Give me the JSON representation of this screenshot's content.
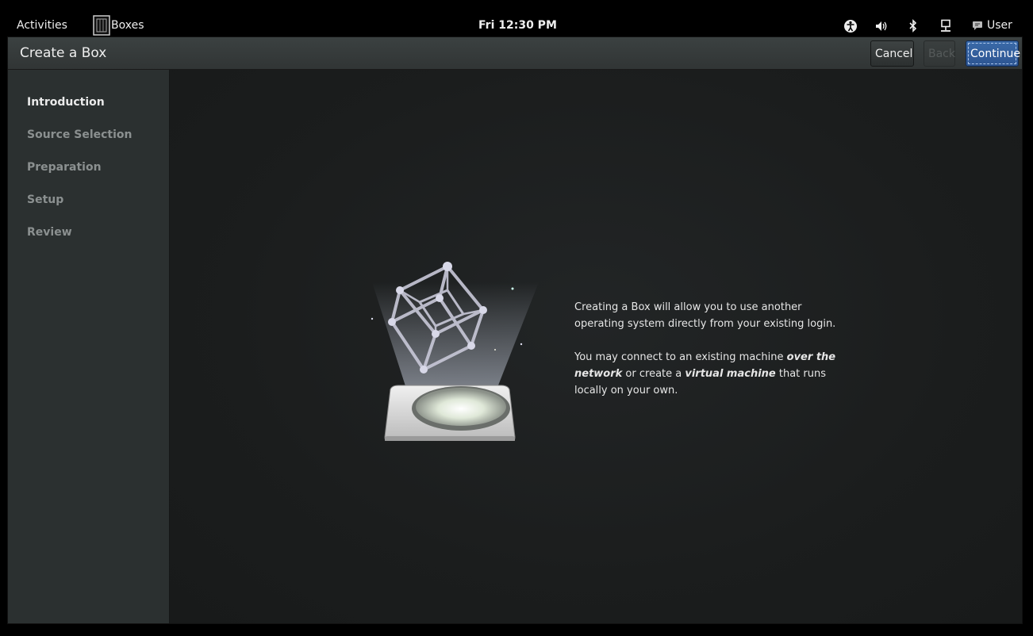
{
  "topbar": {
    "activities": "Activities",
    "app_name": "Boxes",
    "clock": "Fri 12:30 PM",
    "user": "User",
    "icons": [
      "accessibility-icon",
      "volume-icon",
      "bluetooth-icon",
      "network-icon",
      "user-status-icon"
    ]
  },
  "window": {
    "title": "Create a Box",
    "buttons": {
      "cancel": "Cancel",
      "back": "Back",
      "continue": "Continue"
    },
    "accent_color": "#2d5592"
  },
  "sidebar": {
    "steps": [
      {
        "label": "Introduction",
        "active": true
      },
      {
        "label": "Source Selection",
        "active": false
      },
      {
        "label": "Preparation",
        "active": false
      },
      {
        "label": "Setup",
        "active": false
      },
      {
        "label": "Review",
        "active": false
      }
    ]
  },
  "content": {
    "para1": "Creating a Box will allow you to use another operating system directly from your existing login.",
    "para2_a": "You may connect to an existing machine ",
    "para2_b": "over the network",
    "para2_c": " or create a ",
    "para2_d": "virtual machine",
    "para2_e": " that runs locally on your own."
  }
}
